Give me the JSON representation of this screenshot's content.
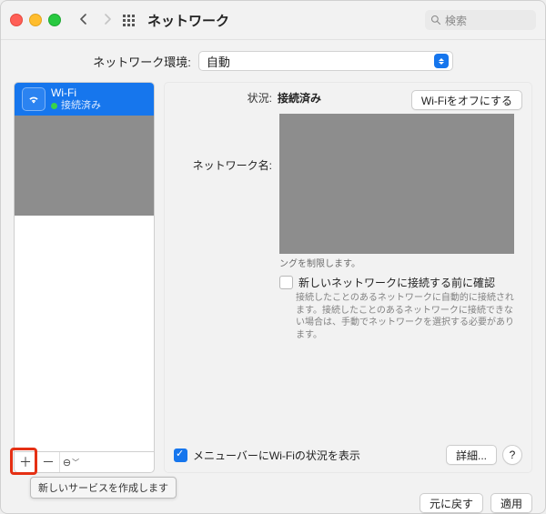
{
  "titlebar": {
    "title": "ネットワーク",
    "search_placeholder": "検索"
  },
  "location": {
    "label": "ネットワーク環境:",
    "selected": "自動"
  },
  "sidebar": {
    "service": {
      "name": "Wi-Fi",
      "status": "接続済み"
    },
    "tooltip": "新しいサービスを作成します",
    "footer": {
      "plus": "＋",
      "minus": "－",
      "more": "⊖"
    }
  },
  "detail": {
    "status_label": "状況:",
    "status_value": "接続済み",
    "wifi_off_button": "Wi-Fiをオフにする",
    "network_name_label": "ネットワーク名:",
    "gray_tail": "ングを制限します。",
    "confirm_before_join": "新しいネットワークに接続する前に確認",
    "confirm_note": "接続したことのあるネットワークに自動的に接続されます。接続したことのあるネットワークに接続できない場合は、手動でネットワークを選択する必要があります。",
    "show_in_menubar": "メニューバーにWi-Fiの状況を表示",
    "advanced_button": "詳細...",
    "help_button": "?"
  },
  "bottom": {
    "revert": "元に戻す",
    "apply": "適用"
  }
}
